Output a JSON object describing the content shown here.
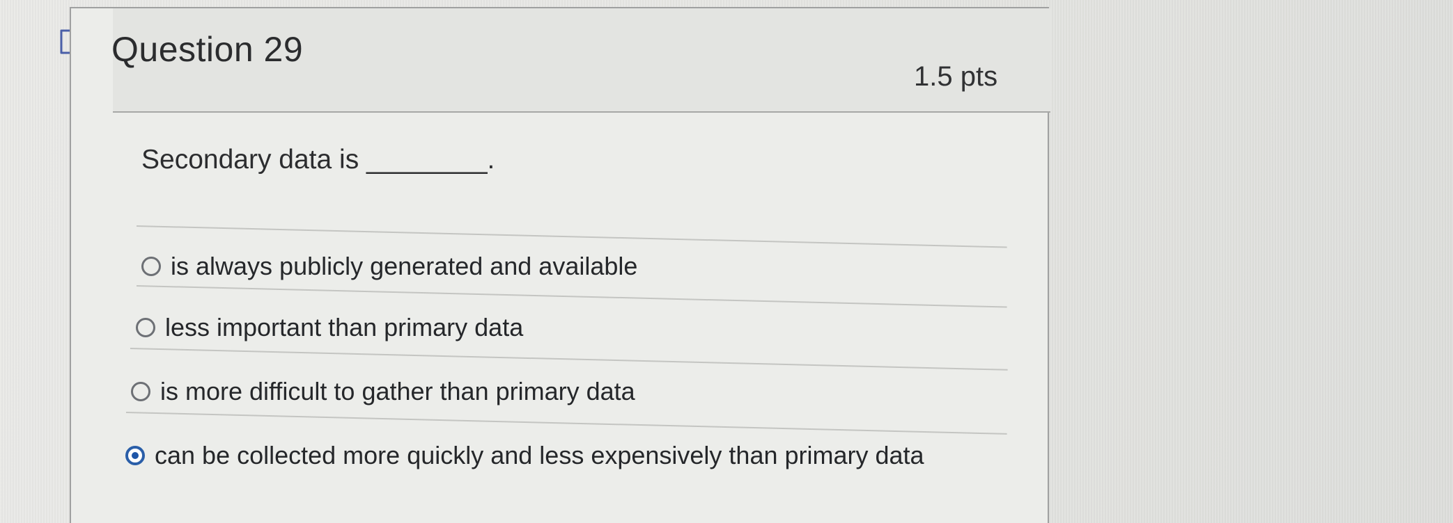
{
  "question": {
    "title": "Question 29",
    "points": "1.5 pts",
    "prompt": "Secondary data is ________."
  },
  "answers": [
    {
      "label": "is always publicly generated and available",
      "selected": false
    },
    {
      "label": "less important than primary data",
      "selected": false
    },
    {
      "label": "is more difficult to gather than primary data",
      "selected": false
    },
    {
      "label": "can be collected more quickly and less expensively than primary data",
      "selected": true
    }
  ],
  "colors": {
    "selected_radio": "#1e56a8",
    "card_border": "#9fa0a0"
  },
  "icons": {
    "flag": "flag-icon"
  }
}
